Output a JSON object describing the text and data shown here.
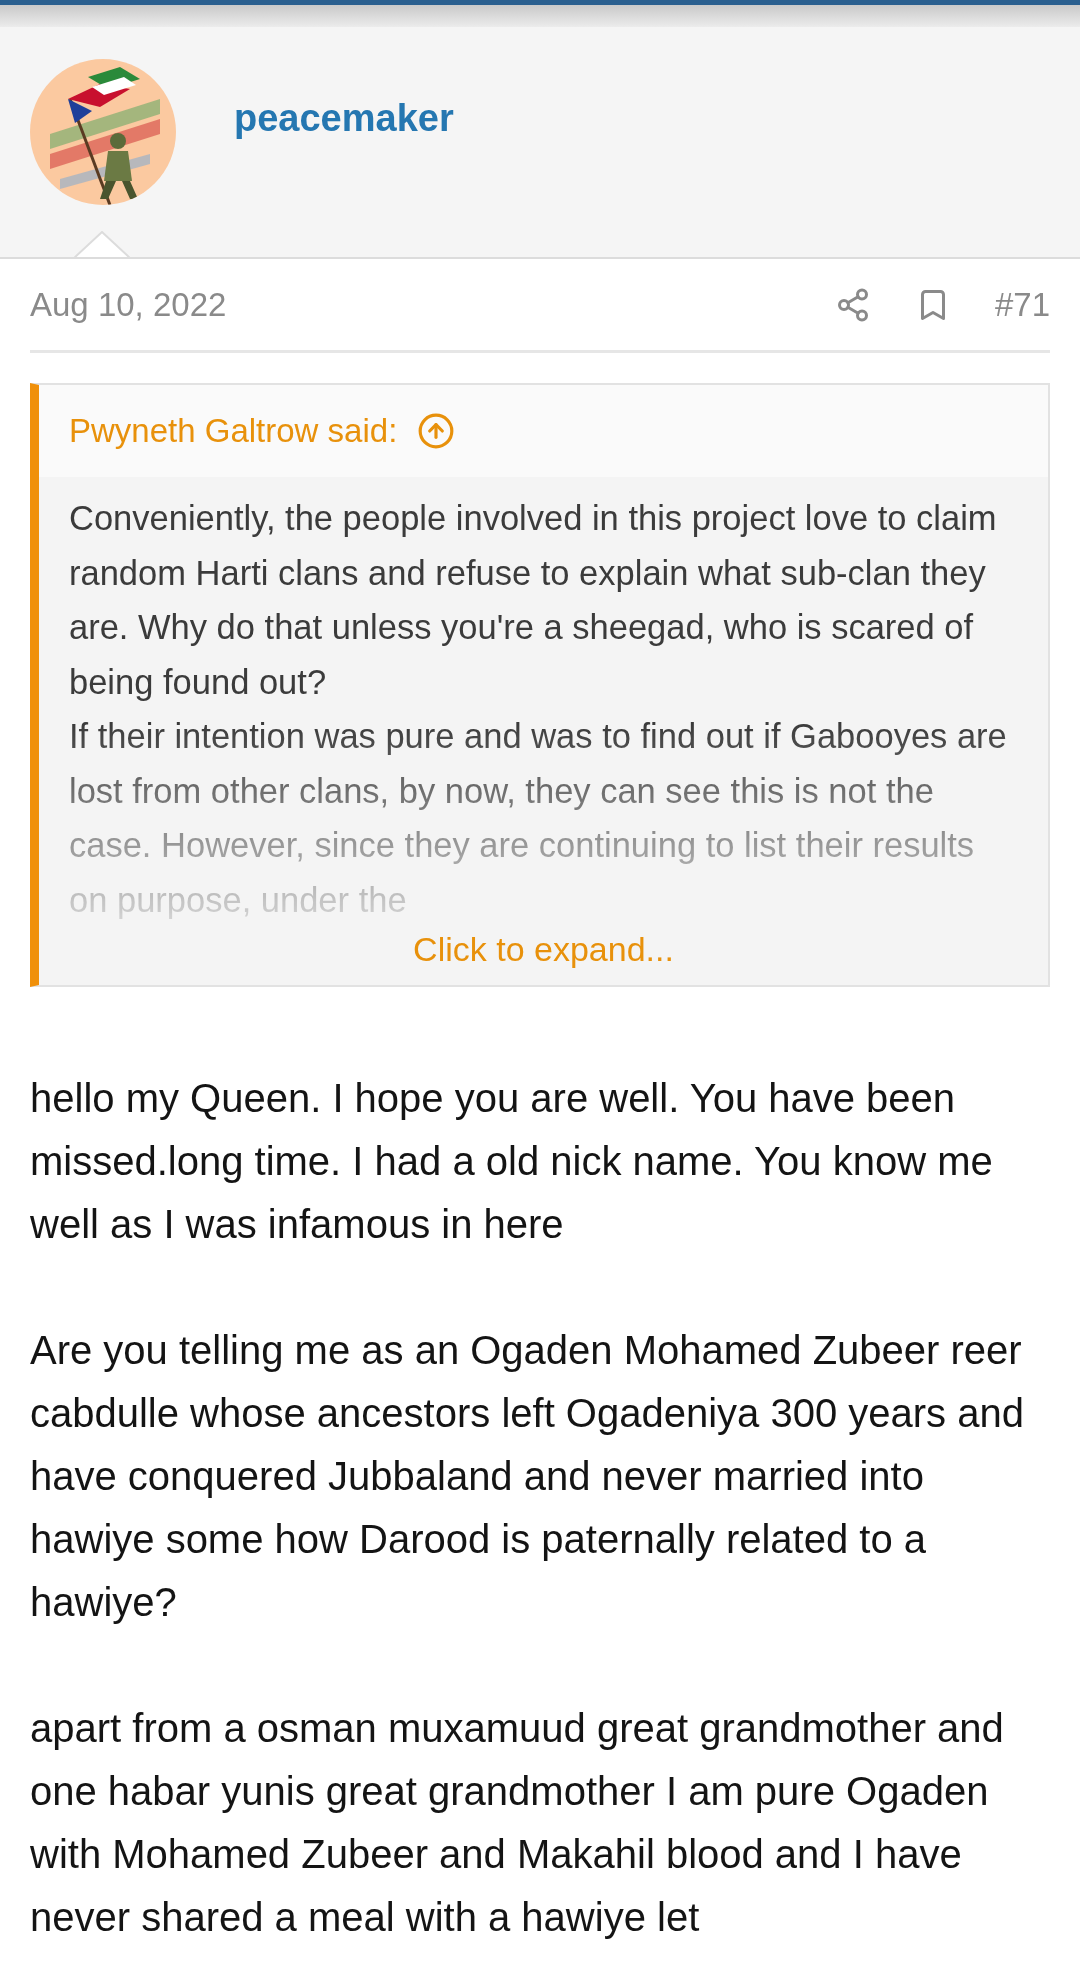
{
  "post": {
    "username": "peacemaker",
    "date": "Aug 10, 2022",
    "number": "#71"
  },
  "quote": {
    "author": "Pwyneth Galtrow said:",
    "paragraphs": [
      "Conveniently, the people involved in this project love to claim random Harti clans and refuse to explain what sub-clan they are. Why do that unless you're a sheegad, who is scared of being found out?",
      "If their intention was pure and was to find out if Gabooyes are lost from other clans, by now, they can see this is not the case. However, since they are continuing to list their results on purpose, under the"
    ],
    "expand": "Click to expand..."
  },
  "body": [
    "hello my Queen. I hope you are well. You have been missed.long time. I had a old nick name. You know me well as I was infamous in here",
    "Are you telling me as an Ogaden Mohamed Zubeer reer cabdulle whose ancestors left Ogadeniya 300 years and have conquered Jubbaland and never married into hawiye some how Darood is paternally related to a hawiye?",
    "apart from a osman muxamuud great grandmother and one habar yunis great grandmother I am pure Ogaden with Mohamed Zubeer and Makahil blood and I have never shared a meal with a hawiye let"
  ]
}
